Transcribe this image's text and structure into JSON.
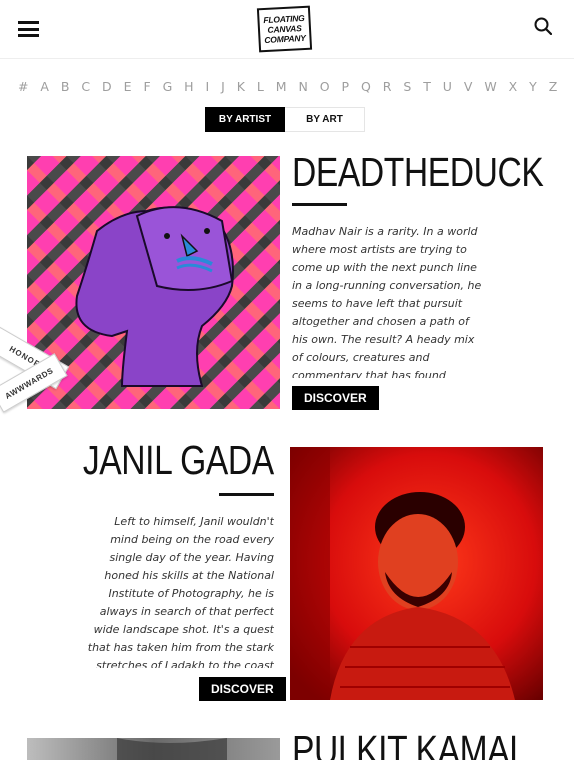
{
  "header": {
    "logo_lines": [
      "FLOATING",
      "CANVAS",
      "COMPANY"
    ]
  },
  "alphabet": [
    "#",
    "A",
    "B",
    "C",
    "D",
    "E",
    "F",
    "G",
    "H",
    "I",
    "J",
    "K",
    "L",
    "M",
    "N",
    "O",
    "P",
    "Q",
    "R",
    "S",
    "T",
    "U",
    "V",
    "W",
    "X",
    "Y",
    "Z"
  ],
  "toggle": {
    "by_artist": "BY ARTIST",
    "by_art": "BY ART"
  },
  "ribbon": {
    "honors": "HONORS",
    "awwwards": "AWWWARDS"
  },
  "artists": [
    {
      "name": "DEADTHEDUCK",
      "bio": "Madhav Nair is a rarity. In a world where most artists are trying to come up with the next punch line in a long-running conversation, he seems to have left that pursuit altogether and chosen a path of his own. The result? A heady mix of colours, creatures and commentary that has found",
      "cta": "DISCOVER"
    },
    {
      "name": "JANIL GADA",
      "bio": "Left to himself, Janil wouldn't mind being on the road every single day of the year. Having honed his skills at the National Institute of Photography, he is always in search of that perfect wide landscape shot. It's a quest that has taken him from the stark stretches of Ladakh to the coast of",
      "cta": "DISCOVER"
    },
    {
      "name": "PULKIT KAMAL"
    }
  ],
  "colors": {
    "accent_black": "#000000",
    "alphabet_gray": "#9e9e9e",
    "pattern_pink": "#ff3fb0",
    "pattern_gray": "#4a4a4a",
    "photo_red": "#e01010"
  }
}
